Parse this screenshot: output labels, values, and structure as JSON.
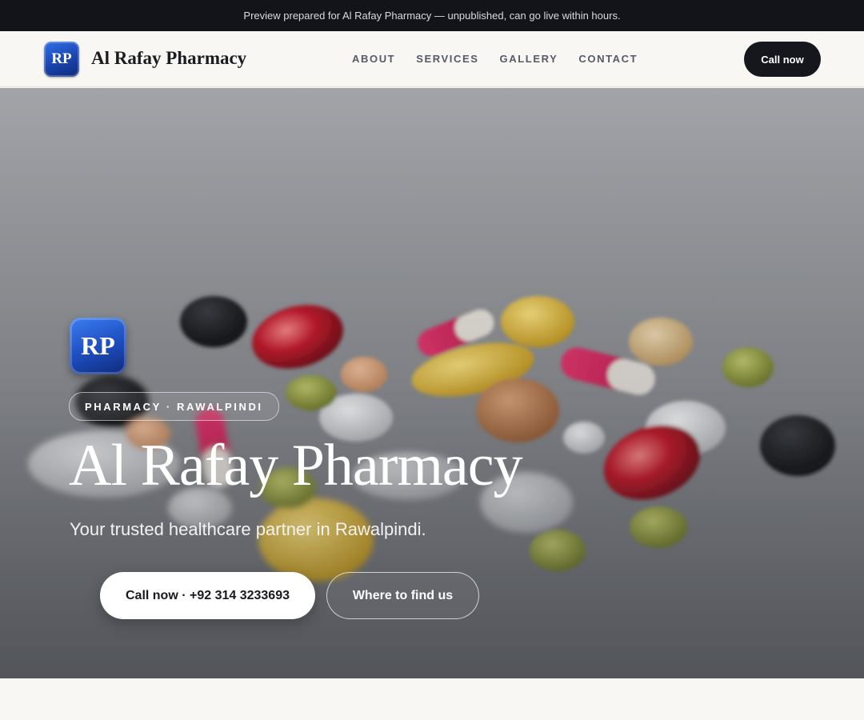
{
  "banner": {
    "text": "Preview prepared for Al Rafay Pharmacy — unpublished, can go live within hours."
  },
  "nav": {
    "logo_initials": "RP",
    "brand": "Al Rafay Pharmacy",
    "links": [
      "ABOUT",
      "SERVICES",
      "GALLERY",
      "CONTACT"
    ],
    "cta": "Call now"
  },
  "hero": {
    "logo_initials": "RP",
    "tag": "PHARMACY · RAWALPINDI",
    "title": "Al Rafay Pharmacy",
    "subtitle": "Your trusted healthcare partner in Rawalpindi.",
    "primary_button": "Call now · +92 314 3233693",
    "secondary_button": "Where to find us",
    "background_image": "pills-and-capsules"
  },
  "colors": {
    "banner_bg": "#121419",
    "page_bg": "#f8f7f3",
    "cta_bg": "#16171c",
    "logo_blue": "#1d4cbc"
  }
}
